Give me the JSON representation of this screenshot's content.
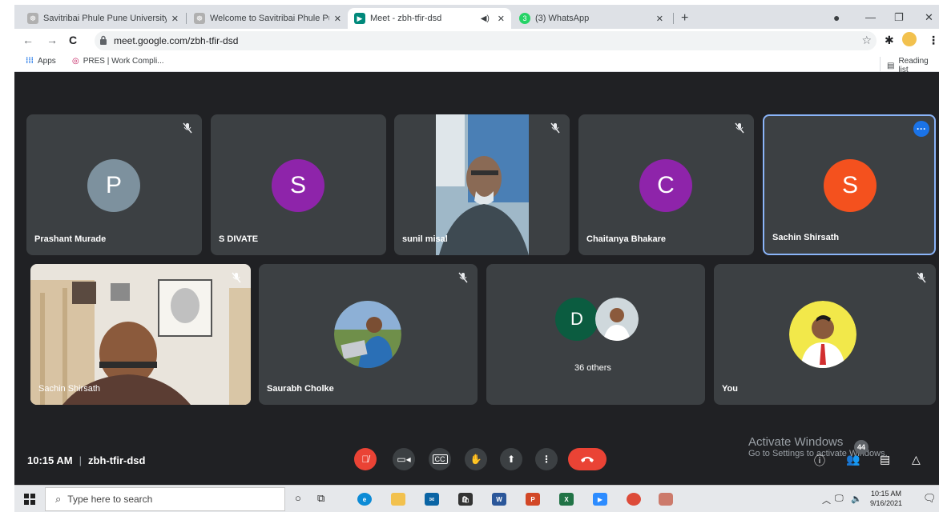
{
  "browser": {
    "tabs": [
      {
        "title": "Savitribai Phule Pune University, ",
        "close": "✕"
      },
      {
        "title": "Welcome to Savitribai Phule Pune",
        "close": "✕"
      },
      {
        "title": "Meet - zbh-tfir-dsd",
        "close": "✕"
      },
      {
        "title": "(3) WhatsApp",
        "close": "✕"
      }
    ],
    "new_tab": "+",
    "url": "meet.google.com/zbh-tfir-dsd",
    "bookmarks": [
      {
        "label": "Apps"
      },
      {
        "label": "PRES | Work Compli..."
      }
    ],
    "reading_list": "Reading list"
  },
  "meet": {
    "participants": [
      {
        "name": "Prashant Murade",
        "initial": "P",
        "color": "#7d919e"
      },
      {
        "name": "S DIVATE",
        "initial": "S",
        "color": "#8e24aa"
      },
      {
        "name": "sunil misal",
        "initial": "",
        "color": ""
      },
      {
        "name": "Chaitanya Bhakare",
        "initial": "C",
        "color": "#8e24aa"
      },
      {
        "name": "Sachin Shirsath",
        "initial": "S",
        "color": "#f4511e"
      },
      {
        "name": "Sachin Shirsath",
        "initial": "",
        "color": ""
      },
      {
        "name": "Saurabh Cholke",
        "initial": "",
        "color": ""
      },
      {
        "name": "36 others",
        "initial": "D",
        "color": "#0b8043"
      },
      {
        "name": "You",
        "initial": "",
        "color": ""
      }
    ],
    "time": "10:15 AM",
    "separator": "|",
    "meeting_code": "zbh-tfir-dsd",
    "activate_title": "Activate Windows",
    "activate_sub": "Go to Settings to activate Windows.",
    "people_count": "44"
  },
  "taskbar": {
    "search_placeholder": "Type here to search",
    "time": "10:15 AM",
    "date": "9/16/2021"
  }
}
